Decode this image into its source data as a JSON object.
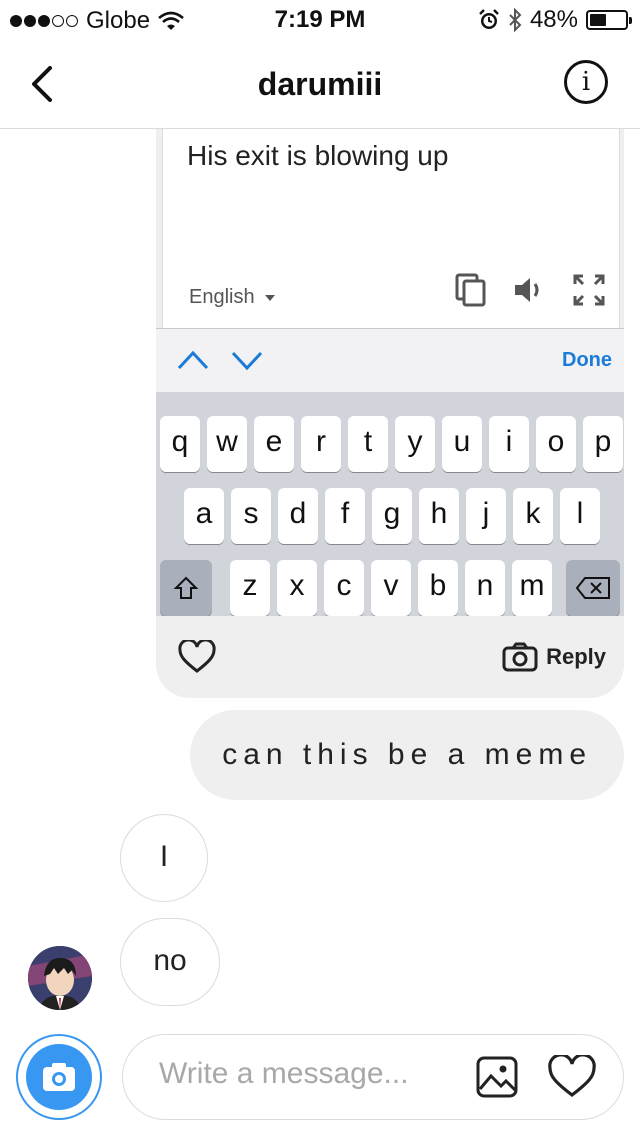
{
  "status": {
    "carrier": "Globe",
    "time": "7:19 PM",
    "battery": "48%",
    "battery_level": 0.48,
    "signal_bars": 3,
    "signal_total": 5
  },
  "header": {
    "title": "darumiii",
    "info_label": "i"
  },
  "shared_image": {
    "translate_text": "His exit is blowing up",
    "language": "English",
    "done_label": "Done",
    "keyboard_rows": [
      [
        "q",
        "w",
        "e",
        "r",
        "t",
        "y",
        "u",
        "i",
        "o",
        "p"
      ],
      [
        "a",
        "s",
        "d",
        "f",
        "g",
        "h",
        "j",
        "k",
        "l"
      ],
      [
        "z",
        "x",
        "c",
        "v",
        "b",
        "n",
        "m"
      ]
    ],
    "reply_label": "Reply"
  },
  "messages": {
    "mine": "can this be a meme",
    "theirs_1": "I",
    "theirs_2": "no"
  },
  "composer": {
    "placeholder": "Write a message..."
  },
  "colors": {
    "accent": "#3897f0",
    "link": "#1a7bd8",
    "bubble": "#efefef",
    "border": "#dbdbdb"
  }
}
